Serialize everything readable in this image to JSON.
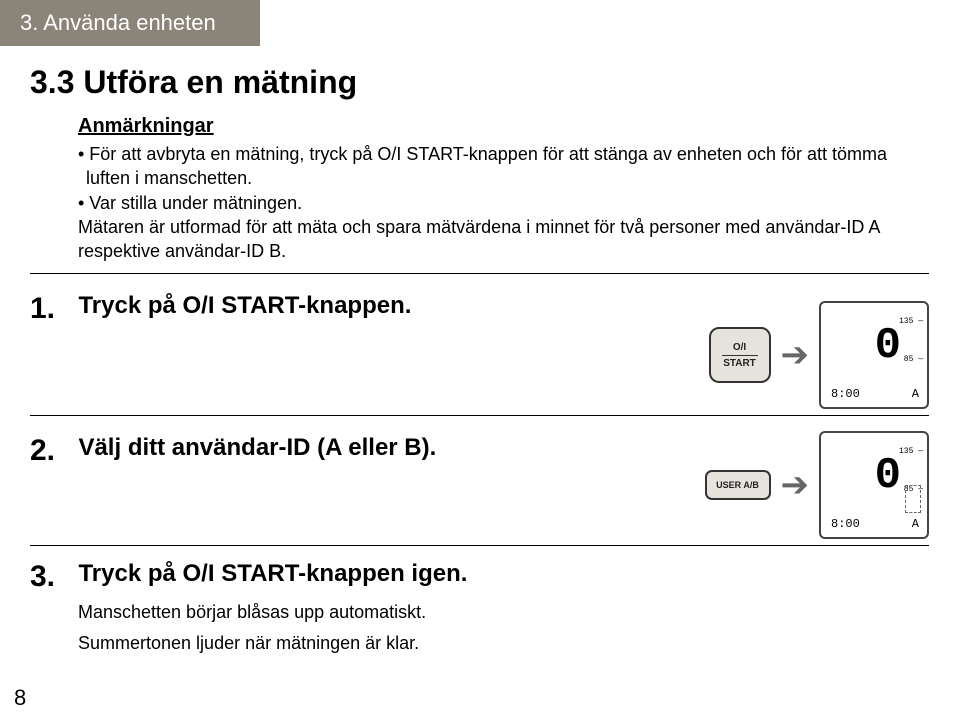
{
  "header": {
    "chapter": "3. Använda enheten"
  },
  "section": {
    "title": "3.3 Utföra en mätning",
    "notes_heading": "Anmärkningar",
    "note1": "• För att avbryta en mätning, tryck på O/I START-knappen för att stänga av enheten och för att tömma luften i manschetten.",
    "note2": "• Var stilla under mätningen.",
    "note2b": "Mätaren är utformad för att mäta och spara mätvärdena i minnet för två personer med användar-ID A respektive användar-ID B."
  },
  "steps": {
    "s1_num": "1.",
    "s1_text": "Tryck på O/I START-knappen.",
    "s2_num": "2.",
    "s2_text": "Välj ditt användar-ID (A eller B).",
    "s3_num": "3.",
    "s3_text": "Tryck på O/I START-knappen igen.",
    "s3_sub1": "Manschetten börjar blåsas upp automatiskt.",
    "s3_sub2": "Summertonen ljuder när mätningen är klar."
  },
  "device": {
    "btn_oi_line1": "O/I",
    "btn_oi_line2": "START",
    "btn_user": "USER A/B",
    "lcd_big": "0",
    "lcd_mark_hi": "135 —",
    "lcd_mark_lo": "85 —",
    "lcd_time": "8:00",
    "lcd_user": "A"
  },
  "page_number": "8"
}
